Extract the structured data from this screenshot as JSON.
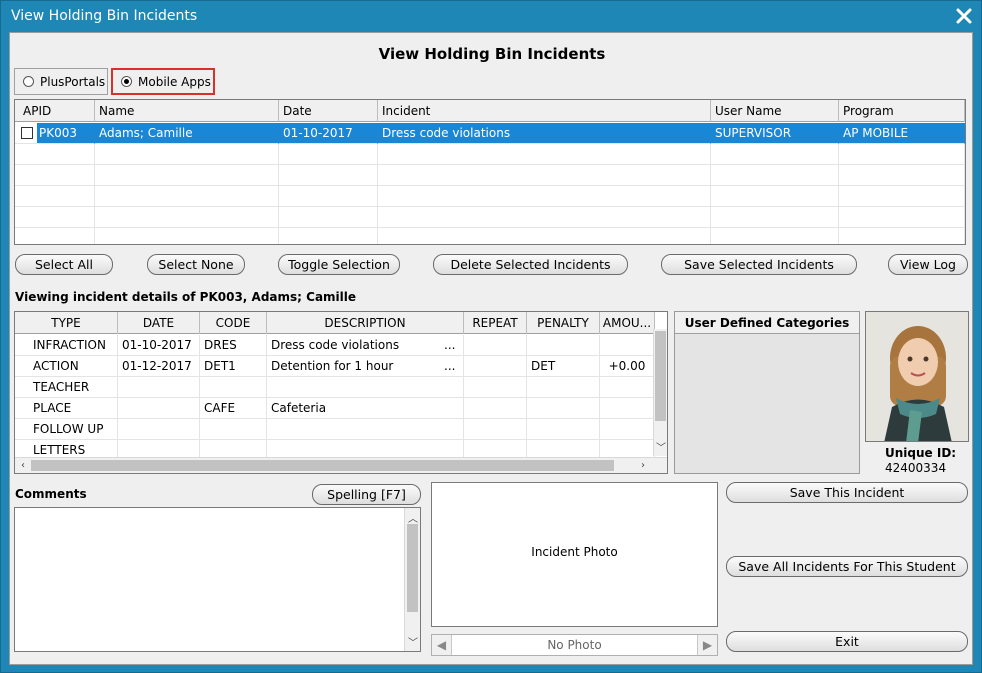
{
  "window": {
    "title": "View Holding Bin Incidents",
    "heading": "View Holding Bin Incidents"
  },
  "source": {
    "options": [
      "PlusPortals",
      "Mobile Apps"
    ],
    "selected": "Mobile Apps"
  },
  "incidents_grid": {
    "columns": [
      "APID",
      "Name",
      "Date",
      "Incident",
      "User Name",
      "Program"
    ],
    "rows": [
      {
        "apid": "PK003",
        "name": "Adams; Camille",
        "date": "01-10-2017",
        "incident": "Dress code violations",
        "user": "SUPERVISOR",
        "program": "AP MOBILE"
      }
    ]
  },
  "actions": {
    "select_all": "Select All",
    "select_none": "Select None",
    "toggle_selection": "Toggle Selection",
    "delete_selected": "Delete Selected Incidents",
    "save_selected": "Save Selected Incidents",
    "view_log": "View Log"
  },
  "details": {
    "caption": "Viewing incident details of PK003, Adams; Camille",
    "columns": [
      "TYPE",
      "DATE",
      "CODE",
      "DESCRIPTION",
      "REPEAT",
      "PENALTY",
      "AMOU..."
    ],
    "rows": [
      {
        "type": "INFRACTION",
        "date": "01-10-2017",
        "code": "DRES",
        "description": "Dress code violations",
        "ellipsis": "...",
        "repeat": "",
        "penalty": "",
        "amount": ""
      },
      {
        "type": "ACTION",
        "date": "01-12-2017",
        "code": "DET1",
        "description": "Detention for 1 hour",
        "ellipsis": "...",
        "repeat": "",
        "penalty": "DET",
        "amount": "+0.00"
      },
      {
        "type": "TEACHER",
        "date": "",
        "code": "",
        "description": "",
        "ellipsis": "",
        "repeat": "",
        "penalty": "",
        "amount": ""
      },
      {
        "type": "PLACE",
        "date": "",
        "code": "CAFE",
        "description": "Cafeteria",
        "ellipsis": "",
        "repeat": "",
        "penalty": "",
        "amount": ""
      },
      {
        "type": "FOLLOW UP",
        "date": "",
        "code": "",
        "description": "",
        "ellipsis": "",
        "repeat": "",
        "penalty": "",
        "amount": ""
      },
      {
        "type": "LETTERS",
        "date": "",
        "code": "",
        "description": "",
        "ellipsis": "",
        "repeat": "",
        "penalty": "",
        "amount": ""
      }
    ]
  },
  "user_categories": {
    "header": "User Defined Categories"
  },
  "student": {
    "unique_id_label": "Unique ID:",
    "unique_id": "42400334"
  },
  "comments": {
    "label": "Comments",
    "value": "",
    "spelling_button": "Spelling [F7]"
  },
  "incident_photo": {
    "label": "Incident Photo",
    "nav_text": "No Photo"
  },
  "side_buttons": {
    "save_this": "Save This Incident",
    "save_all": "Save All Incidents For This Student",
    "exit": "Exit"
  }
}
